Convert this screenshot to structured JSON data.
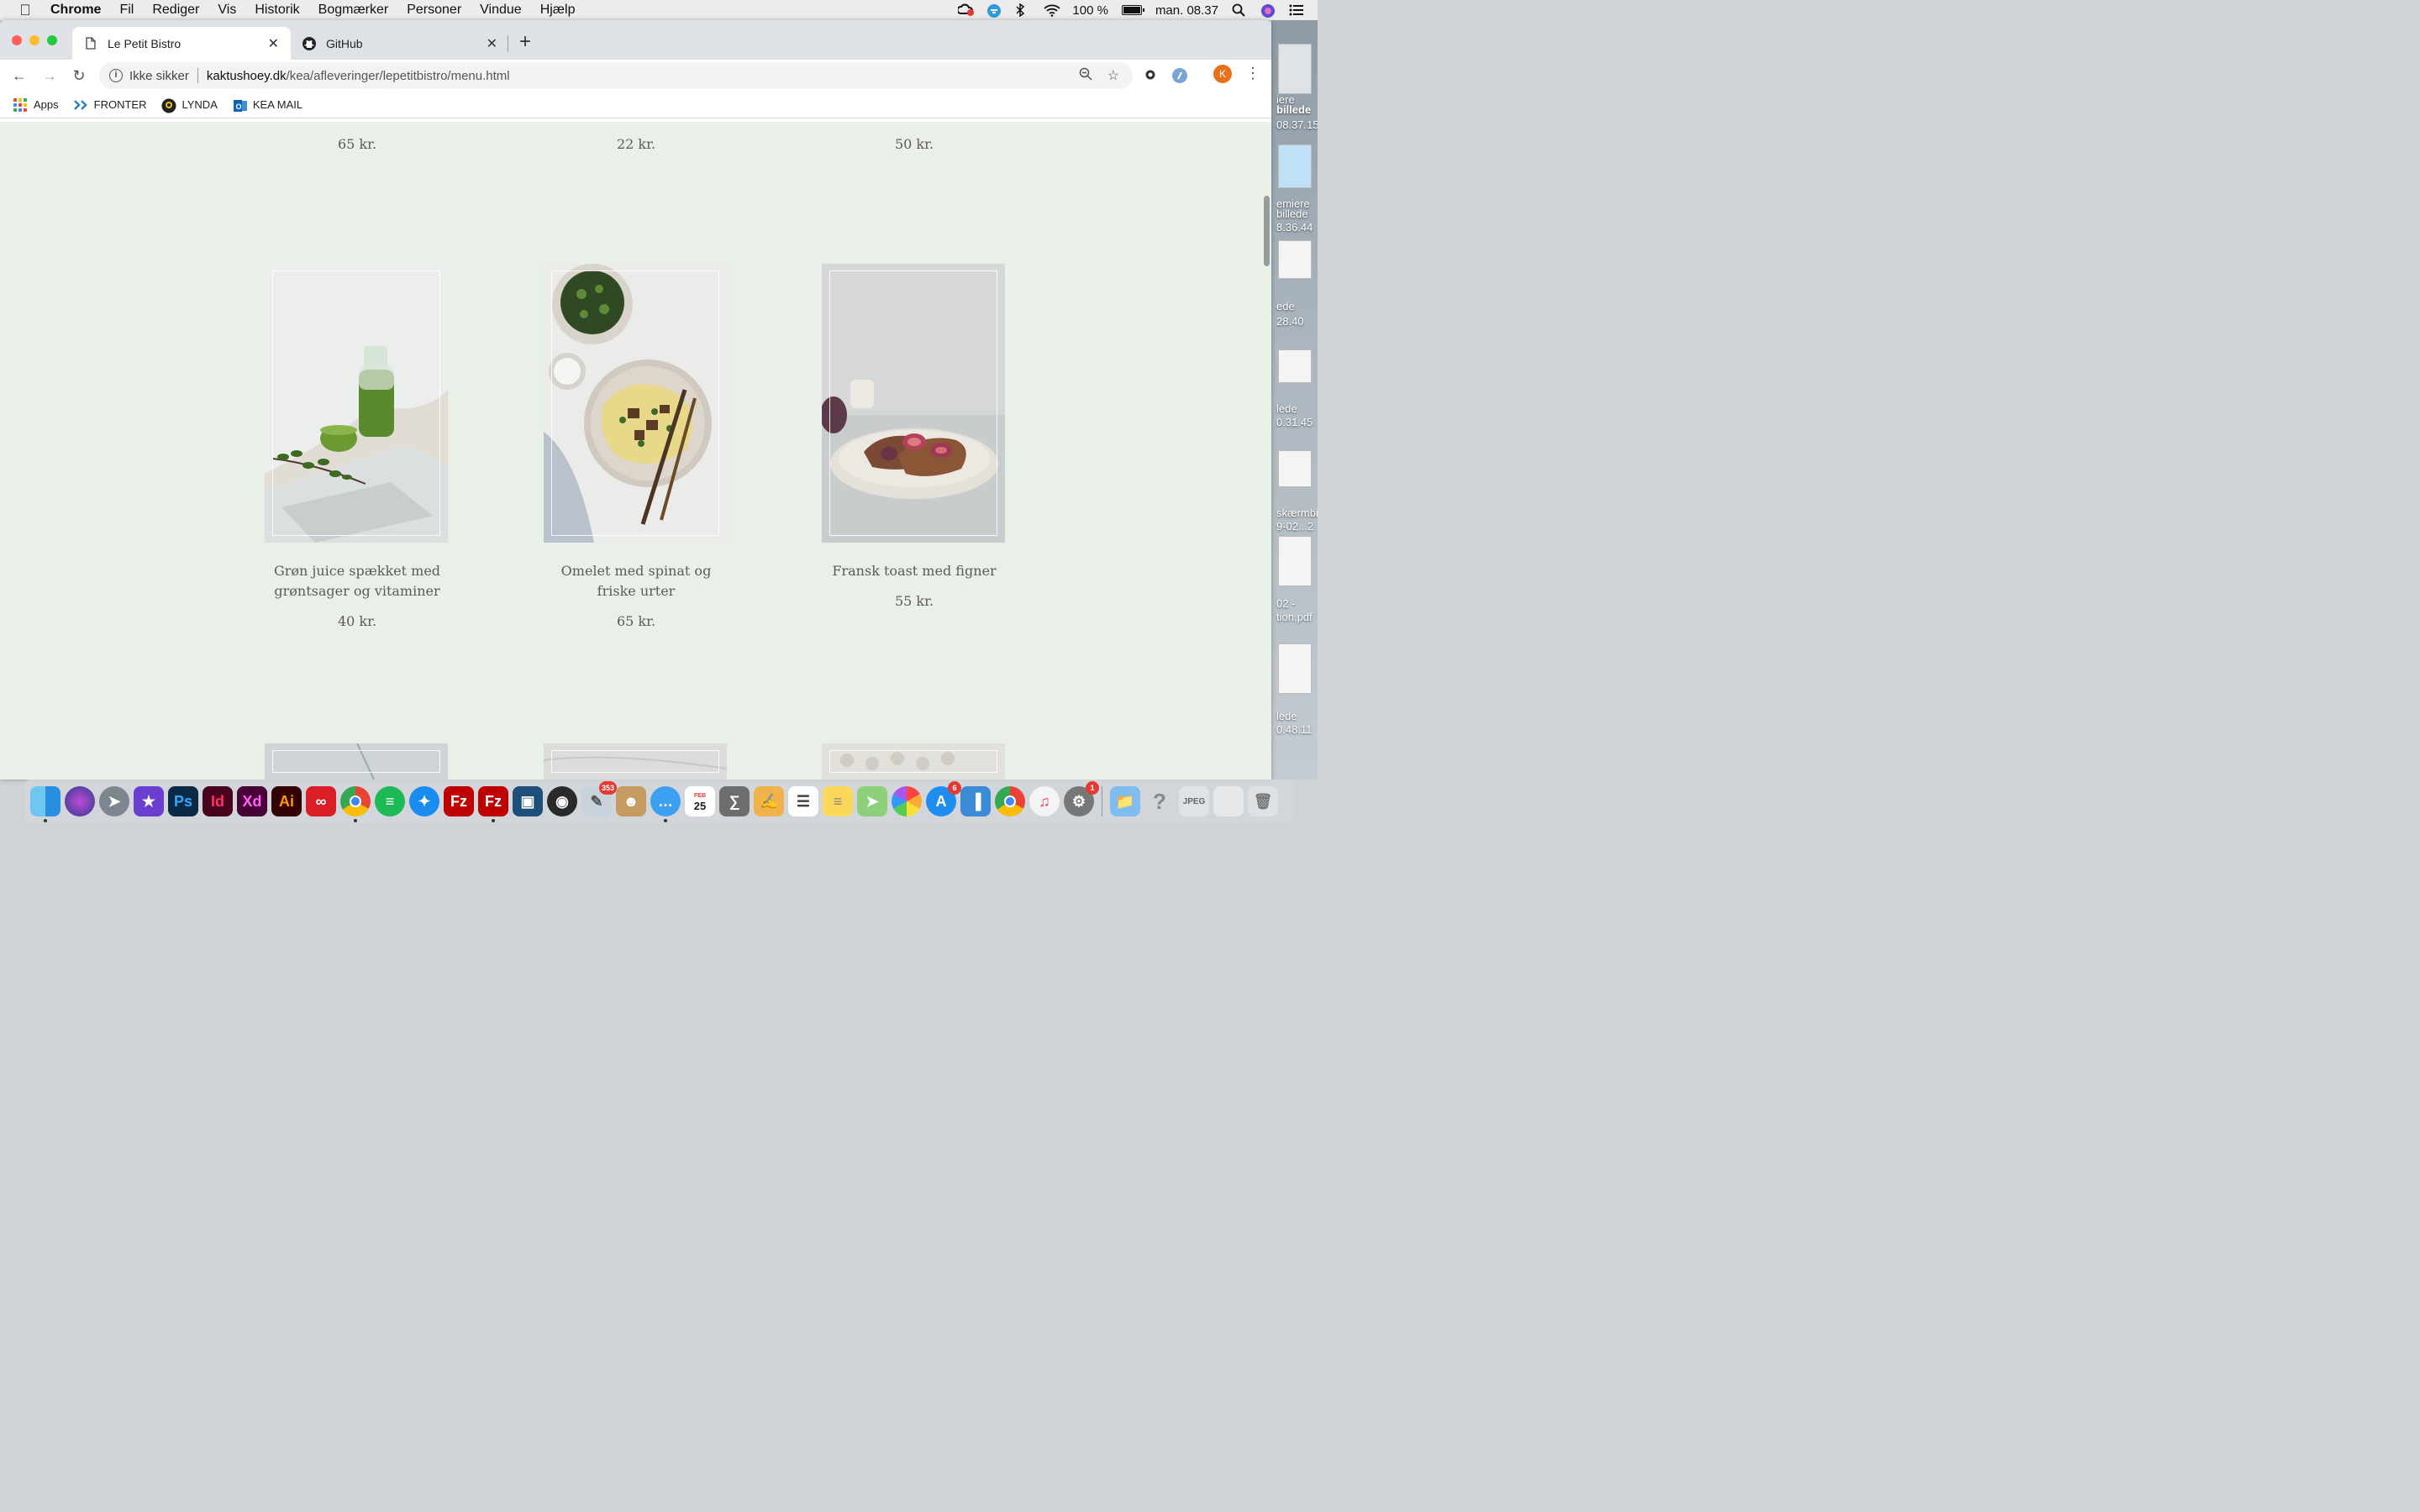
{
  "menubar": {
    "app_name": "Chrome",
    "items": [
      "Fil",
      "Rediger",
      "Vis",
      "Historik",
      "Bogmærker",
      "Personer",
      "Vindue",
      "Hjælp"
    ],
    "battery": "100 %",
    "clock": "man. 08.37"
  },
  "browser": {
    "tabs": [
      {
        "title": "Le Petit Bistro",
        "icon": "page-icon",
        "active": true
      },
      {
        "title": "GitHub",
        "icon": "github-icon",
        "active": false
      }
    ],
    "omnibox": {
      "security": "Ikke sikker",
      "host": "kaktushoey.dk",
      "path": "/kea/afleveringer/lepetitbistro/menu.html"
    },
    "avatar_letter": "K",
    "bookmarks": [
      {
        "label": "Apps",
        "icon": "apps-grid-icon"
      },
      {
        "label": "FRONTER",
        "icon": "fronter-icon"
      },
      {
        "label": "LYNDA",
        "icon": "lynda-icon"
      },
      {
        "label": "KEA MAIL",
        "icon": "outlook-icon"
      }
    ]
  },
  "page": {
    "top_prices": [
      "65 kr.",
      "22 kr.",
      "50 kr."
    ],
    "dishes": [
      {
        "name": "Grøn juice spækket med grøntsager og vitaminer",
        "price": "40 kr.",
        "photo": "green-juice-photo"
      },
      {
        "name": "Omelet med spinat og friske urter",
        "price": "65 kr.",
        "photo": "omelet-photo"
      },
      {
        "name": "Fransk toast med figner",
        "price": "55 kr.",
        "photo": "french-toast-photo"
      }
    ],
    "background_color": "#e9f0e8",
    "text_color": "#5f5a55"
  },
  "desktop": {
    "files": [
      "iere",
      "billede",
      "08.37.15",
      "emiere",
      "billede",
      "8.36.44",
      "ede",
      "28.40",
      "lede",
      "0.31.45",
      "skærmbi",
      "9-02...2",
      "02 -",
      "tion.pdf",
      "lede",
      "0.48.11"
    ]
  },
  "dock": {
    "badges": {
      "preview": "353",
      "appstore": "6",
      "settings": "1"
    },
    "calendar_month": "FEB",
    "calendar_day": "25"
  }
}
